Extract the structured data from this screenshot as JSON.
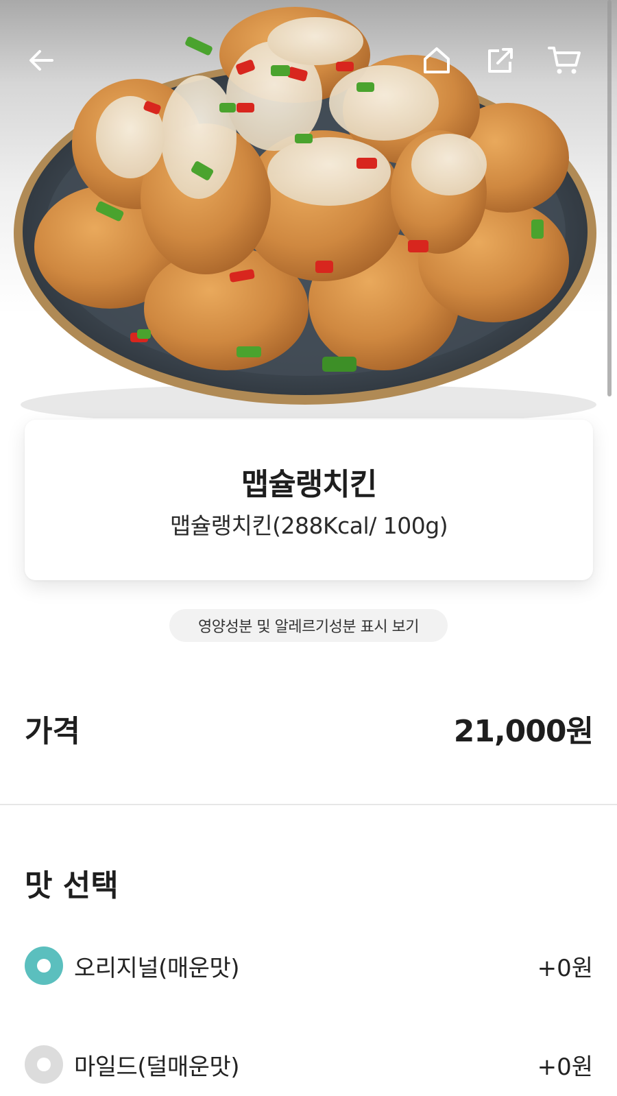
{
  "header": {
    "back_icon": "arrow-left-icon",
    "home_icon": "home-icon",
    "share_icon": "share-icon",
    "cart_icon": "cart-icon"
  },
  "hero_image": {
    "subject": "plate of sauced fried chicken"
  },
  "product": {
    "name": "맵슐랭치킨",
    "description": "맵슐랭치킨(288Kcal/ 100g)"
  },
  "nutrition_button_label": "영양성분 및 알레르기성분 표시 보기",
  "price": {
    "label": "가격",
    "value": "21,000원"
  },
  "flavor": {
    "title": "맛 선택",
    "options": [
      {
        "label": "오리지널(매운맛)",
        "price": "+0원",
        "selected": true
      },
      {
        "label": "마일드(덜매운맛)",
        "price": "+0원",
        "selected": false
      }
    ]
  },
  "colors": {
    "accent": "#5bbfbe",
    "radio_unselected": "#dcdcdc",
    "text": "#1e1e1e"
  }
}
